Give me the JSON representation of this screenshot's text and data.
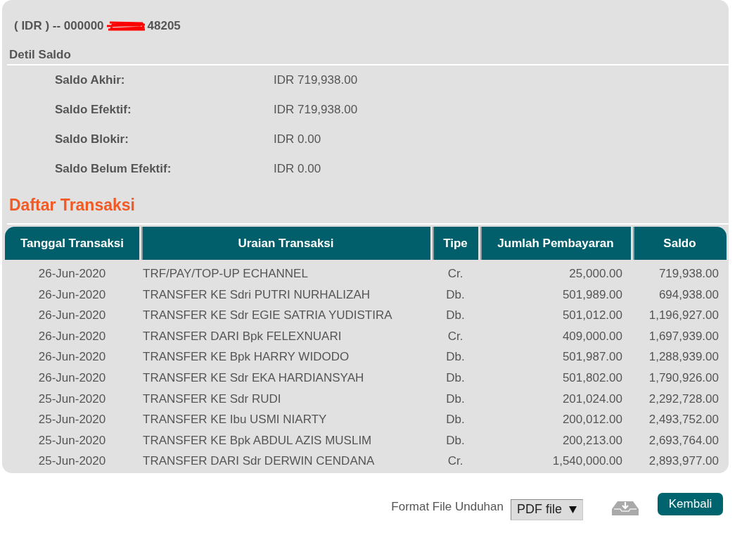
{
  "account": {
    "prefix": "( IDR ) -- 000000",
    "redacted": true,
    "suffix": "48205"
  },
  "balance_section": {
    "title": "Detil Saldo",
    "items": [
      {
        "label": "Saldo Akhir:",
        "value": "IDR 719,938.00"
      },
      {
        "label": "Saldo Efektif:",
        "value": "IDR 719,938.00"
      },
      {
        "label": "Saldo Blokir:",
        "value": "IDR 0.00"
      },
      {
        "label": "Saldo Belum Efektif:",
        "value": "IDR 0.00"
      }
    ]
  },
  "transactions": {
    "title": "Daftar Transaksi",
    "columns": [
      "Tanggal Transaksi",
      "Uraian Transaksi",
      "Tipe",
      "Jumlah Pembayaran",
      "Saldo"
    ],
    "rows": [
      [
        "26-Jun-2020",
        "TRF/PAY/TOP-UP ECHANNEL",
        "Cr.",
        "25,000.00",
        "719,938.00"
      ],
      [
        "26-Jun-2020",
        "TRANSFER KE Sdri PUTRI NURHALIZAH",
        "Db.",
        "501,989.00",
        "694,938.00"
      ],
      [
        "26-Jun-2020",
        "TRANSFER KE Sdr EGIE SATRIA YUDISTIRA",
        "Db.",
        "501,012.00",
        "1,196,927.00"
      ],
      [
        "26-Jun-2020",
        "TRANSFER DARI Bpk FELEXNUARI",
        "Cr.",
        "409,000.00",
        "1,697,939.00"
      ],
      [
        "26-Jun-2020",
        "TRANSFER KE Bpk HARRY WIDODO",
        "Db.",
        "501,987.00",
        "1,288,939.00"
      ],
      [
        "26-Jun-2020",
        "TRANSFER KE Sdr EKA HARDIANSYAH",
        "Db.",
        "501,802.00",
        "1,790,926.00"
      ],
      [
        "25-Jun-2020",
        "TRANSFER KE Sdr RUDI",
        "Db.",
        "201,024.00",
        "2,292,728.00"
      ],
      [
        "25-Jun-2020",
        "TRANSFER KE Ibu USMI NIARTY",
        "Db.",
        "200,012.00",
        "2,493,752.00"
      ],
      [
        "25-Jun-2020",
        "TRANSFER KE Bpk ABDUL AZIS MUSLIM",
        "Db.",
        "200,213.00",
        "2,693,764.00"
      ],
      [
        "25-Jun-2020",
        "TRANSFER DARI Sdr DERWIN CENDANA",
        "Cr.",
        "1,540,000.00",
        "2,893,977.00"
      ]
    ]
  },
  "footer": {
    "format_label": "Format File Unduhan",
    "format_select": {
      "value": "PDF file"
    },
    "back_button": "Kembali"
  }
}
